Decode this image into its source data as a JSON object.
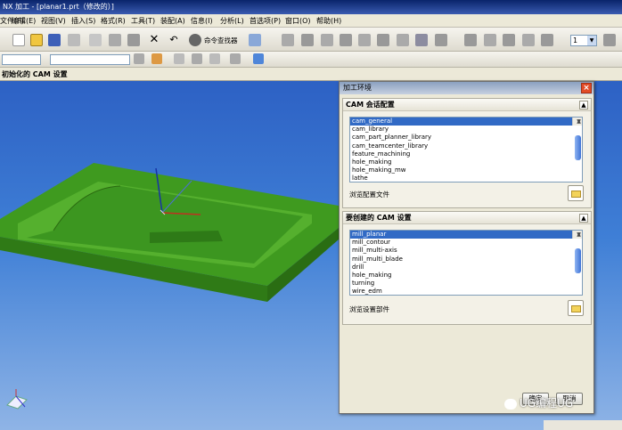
{
  "window": {
    "title": "NX 加工 - [planar1.prt（修改的）]"
  },
  "menu": [
    {
      "label": "文件(F)"
    },
    {
      "label": "编辑(E)"
    },
    {
      "label": "视图(V)"
    },
    {
      "label": "插入(S)"
    },
    {
      "label": "格式(R)"
    },
    {
      "label": "工具(T)"
    },
    {
      "label": "装配(A)"
    },
    {
      "label": "信息(I)"
    },
    {
      "label": "分析(L)"
    },
    {
      "label": "首选项(P)"
    },
    {
      "label": "窗口(O)"
    },
    {
      "label": "帮助(H)"
    }
  ],
  "toolbar": {
    "command_finder": "命令查找器",
    "zoom_value": "1"
  },
  "navigator": {
    "title": "初始化的 CAM 设置"
  },
  "dialog": {
    "title": "加工环境",
    "session_group": {
      "title": "CAM 会话配置",
      "items": [
        "cam_general",
        "cam_library",
        "cam_part_planner_library",
        "cam_teamcenter_library",
        "feature_machining",
        "hole_making",
        "hole_making_mw",
        "lathe"
      ],
      "selected": "cam_general",
      "browse_label": "浏览配置文件"
    },
    "setup_group": {
      "title": "要创建的 CAM 设置",
      "items": [
        "mill_planar",
        "mill_contour",
        "mill_multi-axis",
        "mill_multi_blade",
        "drill",
        "hole_making",
        "turning",
        "wire_edm"
      ],
      "selected": "mill_planar",
      "browse_label": "浏览设置部件"
    },
    "ok_label": "确定",
    "cancel_label": "取消"
  },
  "watermark": {
    "text": "UG编程UG"
  }
}
